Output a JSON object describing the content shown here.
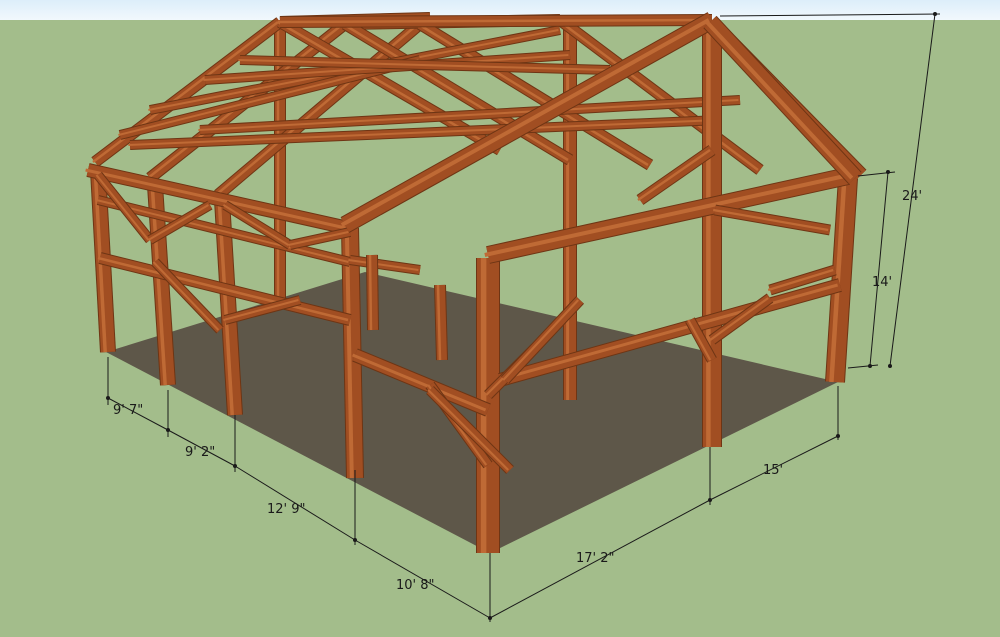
{
  "scene": {
    "sky_color": "#e9f3fb",
    "ground_color": "#a3bd8b",
    "floor_color": "#5e5749",
    "timber_color": "#a14e22",
    "timber_dark": "#6e3514",
    "timber_light": "#bf6a35"
  },
  "dimensions": {
    "bay_1": "9' 7\"",
    "bay_2": "9' 2\"",
    "bay_3": "12' 9\"",
    "bay_4": "10' 8\"",
    "width_1": "17' 2\"",
    "width_2": "15'",
    "eave_height": "14'",
    "ridge_height": "24'"
  }
}
